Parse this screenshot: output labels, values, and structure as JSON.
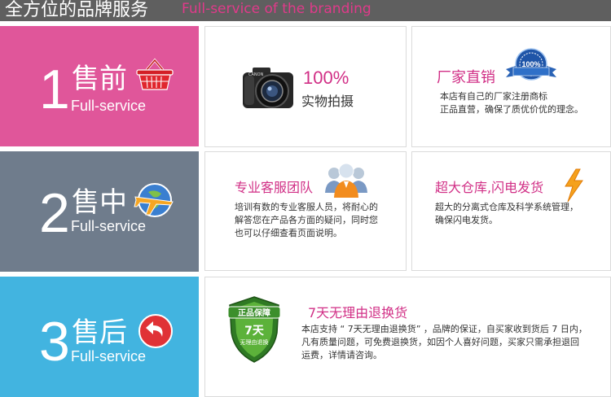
{
  "header": {
    "title": "全方位的品牌服务",
    "subtitle": "Full-service of the branding"
  },
  "colors": {
    "pink": "#e0569a",
    "gray": "#6f7c8c",
    "blue": "#42b4e0",
    "magenta": "#d12f86",
    "header": "#5f5f5f"
  },
  "stages": [
    {
      "number": "1",
      "title": "售前",
      "subtitle": "Full-service",
      "icon": "basket-icon"
    },
    {
      "number": "2",
      "title": "售中",
      "subtitle": "Full-service",
      "icon": "airplane-icon"
    },
    {
      "number": "3",
      "title": "售后",
      "subtitle": "Full-service",
      "icon": "return-arrow-icon"
    }
  ],
  "cards": {
    "authentic": {
      "percent": "100%",
      "label": "实物拍摄",
      "icon": "camera-icon"
    },
    "factory": {
      "title": "厂家直销",
      "badge": "100%",
      "desc_line1": "本店有自己的厂家注册商标",
      "desc_line2": "正品直营，确保了质优价优的理念。",
      "icon": "guarantee-seal-icon"
    },
    "service": {
      "title": "专业客服团队",
      "desc_line1": "培训有数的专业客服人员，将耐心的",
      "desc_line2": "解答您在产品各方面的疑问，同时您",
      "desc_line3": "也可以仔细查看页面说明。",
      "icon": "team-icon"
    },
    "warehouse": {
      "title": "超大仓库,闪电发货",
      "desc_line1": "超大的分离式仓库及科学系统管理，",
      "desc_line2": "确保闪电发货。",
      "icon": "lightning-icon"
    },
    "returns": {
      "title": "7天无理由退换货",
      "shield_top": "正品保障",
      "shield_days": "7天",
      "shield_sub": "无理由退换",
      "desc_line1": "本店支持 “ 7天无理由退换货” ，品牌的保证，自买家收到货后 7 日内，",
      "desc_line2": "凡有质量问题，可免费退换货，如因个人喜好问题，买家只需承担退回",
      "desc_line3": "运费，详情请咨询。",
      "icon": "shield-icon"
    }
  }
}
